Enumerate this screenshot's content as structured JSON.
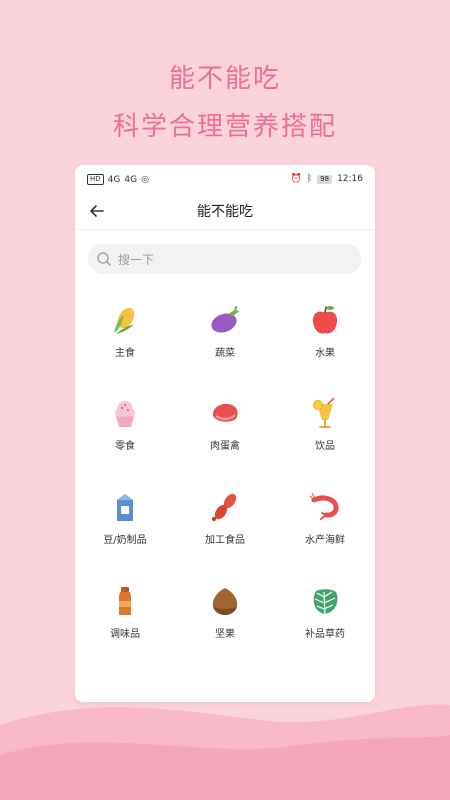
{
  "promo": {
    "line1": "能不能吃",
    "line2": "科学合理营养搭配"
  },
  "status_bar": {
    "left": [
      "HD",
      "4G",
      "4G",
      "◎"
    ],
    "battery": "98",
    "time": "12:16"
  },
  "nav": {
    "title": "能不能吃"
  },
  "search": {
    "placeholder": "搜一下"
  },
  "categories": [
    {
      "label": "主食",
      "icon": "corn-icon"
    },
    {
      "label": "蔬菜",
      "icon": "eggplant-icon"
    },
    {
      "label": "水果",
      "icon": "apple-icon"
    },
    {
      "label": "零食",
      "icon": "cupcake-icon"
    },
    {
      "label": "肉蛋禽",
      "icon": "meat-icon"
    },
    {
      "label": "饮品",
      "icon": "drink-icon"
    },
    {
      "label": "豆/奶制品",
      "icon": "milk-carton-icon"
    },
    {
      "label": "加工食品",
      "icon": "sausage-icon"
    },
    {
      "label": "水产海鲜",
      "icon": "shrimp-icon"
    },
    {
      "label": "调味品",
      "icon": "sauce-bottle-icon"
    },
    {
      "label": "坚果",
      "icon": "chestnut-icon"
    },
    {
      "label": "补品草药",
      "icon": "leaf-icon"
    }
  ],
  "colors": {
    "background": "#fbd3dd",
    "accent": "#f06e93"
  }
}
